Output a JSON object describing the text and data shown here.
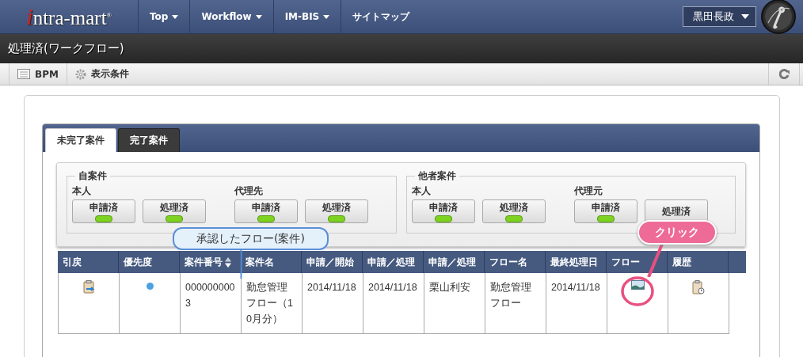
{
  "header": {
    "logo": "intra-mart",
    "logo_mark": "®",
    "nav": [
      {
        "label": "Top",
        "dropdown": true
      },
      {
        "label": "Workflow",
        "dropdown": true
      },
      {
        "label": "IM-BIS",
        "dropdown": true
      },
      {
        "label": "サイトマップ",
        "dropdown": false
      }
    ],
    "user": "黒田長政"
  },
  "page_title": "処理済(ワークフロー)",
  "toolbar": {
    "items": [
      {
        "label": "BPM",
        "kind": "list"
      },
      {
        "label": "表示条件",
        "kind": "gear"
      }
    ]
  },
  "tabs": [
    {
      "label": "未完了案件",
      "selected": true
    },
    {
      "label": "完了案件",
      "selected": false
    }
  ],
  "filters": [
    {
      "legend": "自案件",
      "groups": [
        {
          "label": "本人",
          "buttons": [
            {
              "label": "申請済",
              "lit": true
            },
            {
              "label": "処理済",
              "lit": true
            }
          ]
        },
        {
          "label": "代理先",
          "buttons": [
            {
              "label": "申請済",
              "lit": true
            },
            {
              "label": "処理済",
              "lit": true
            }
          ]
        }
      ]
    },
    {
      "legend": "他者案件",
      "groups": [
        {
          "label": "本人",
          "buttons": [
            {
              "label": "申請済",
              "lit": true
            },
            {
              "label": "処理済",
              "lit": true
            }
          ]
        },
        {
          "label": "代理元",
          "buttons": [
            {
              "label": "申請済",
              "lit": true
            },
            {
              "label": "処理済"
            }
          ]
        }
      ]
    }
  ],
  "table": {
    "columns": [
      {
        "label": "引戻",
        "sortable": false
      },
      {
        "label": "優先度",
        "sortable": false
      },
      {
        "label": "案件番号",
        "sortable": true
      },
      {
        "label": "案件名",
        "sortable": false
      },
      {
        "label": "申請／開始",
        "sortable": false
      },
      {
        "label": "申請／処理",
        "sortable": false
      },
      {
        "label": "申請／処理",
        "sortable": false
      },
      {
        "label": "フロー名",
        "sortable": false
      },
      {
        "label": "最終処理日",
        "sortable": false
      },
      {
        "label": "フロー",
        "sortable": false
      },
      {
        "label": "履歴",
        "sortable": false
      }
    ],
    "rows": [
      {
        "cells": [
          {
            "kind": "pullback"
          },
          {
            "kind": "dot",
            "color": "#4aa3df"
          },
          {
            "kind": "text",
            "text": "0000000003"
          },
          {
            "kind": "text",
            "text": "勤怠管理フロー（10月分）"
          },
          {
            "kind": "text",
            "text": "2014/11/18"
          },
          {
            "kind": "text",
            "text": "2014/11/18"
          },
          {
            "kind": "text",
            "text": "栗山利安"
          },
          {
            "kind": "text",
            "text": "勤怠管理フロー"
          },
          {
            "kind": "text",
            "text": "2014/11/18"
          },
          {
            "kind": "flow"
          },
          {
            "kind": "history"
          }
        ]
      }
    ]
  },
  "callouts": [
    {
      "kind": "note",
      "text": "承認したフロー(案件)"
    },
    {
      "kind": "action",
      "text": "クリック"
    }
  ]
}
